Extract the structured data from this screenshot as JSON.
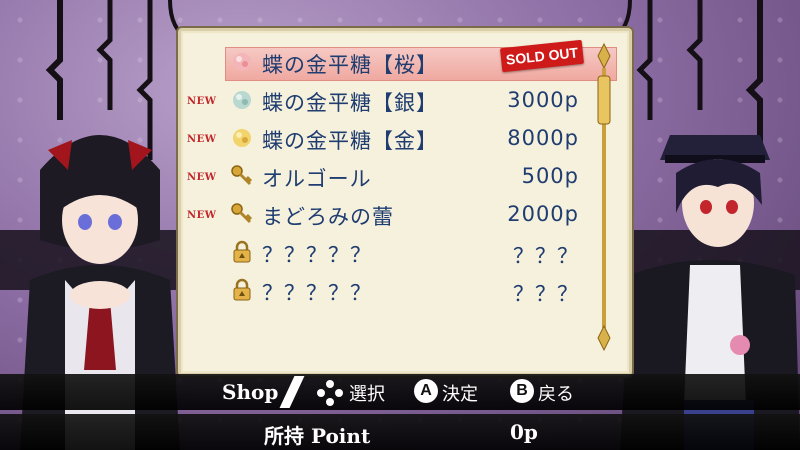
{
  "shop": {
    "items": [
      {
        "new": "",
        "icon": "konpeito-pink-icon",
        "name": "蝶の金平糖【桜】",
        "price": "",
        "sold_out": "SOLD OUT",
        "selected": true
      },
      {
        "new": "NEW",
        "icon": "konpeito-silver-icon",
        "name": "蝶の金平糖【銀】",
        "price": "3000p"
      },
      {
        "new": "NEW",
        "icon": "konpeito-gold-icon",
        "name": "蝶の金平糖【金】",
        "price": "8000p"
      },
      {
        "new": "NEW",
        "icon": "key-icon",
        "name": "オルゴール",
        "price": "500p"
      },
      {
        "new": "NEW",
        "icon": "key-icon",
        "name": "まどろみの蕾",
        "price": "2000p"
      },
      {
        "new": "",
        "icon": "padlock-icon",
        "name": "？？？？？",
        "price": "？？？"
      },
      {
        "new": "",
        "icon": "padlock-icon",
        "name": "？？？？？",
        "price": "？？？"
      }
    ]
  },
  "controls": {
    "title": "Shop",
    "select": "選択",
    "a_key": "A",
    "decide": "決定",
    "b_key": "B",
    "back": "戻る"
  },
  "points": {
    "label": "所持 Point",
    "value": "0p"
  },
  "colors": {
    "text_blue": "#1f3d70",
    "new_red": "#c2262a",
    "panel_bg": "#f6f1dd"
  }
}
